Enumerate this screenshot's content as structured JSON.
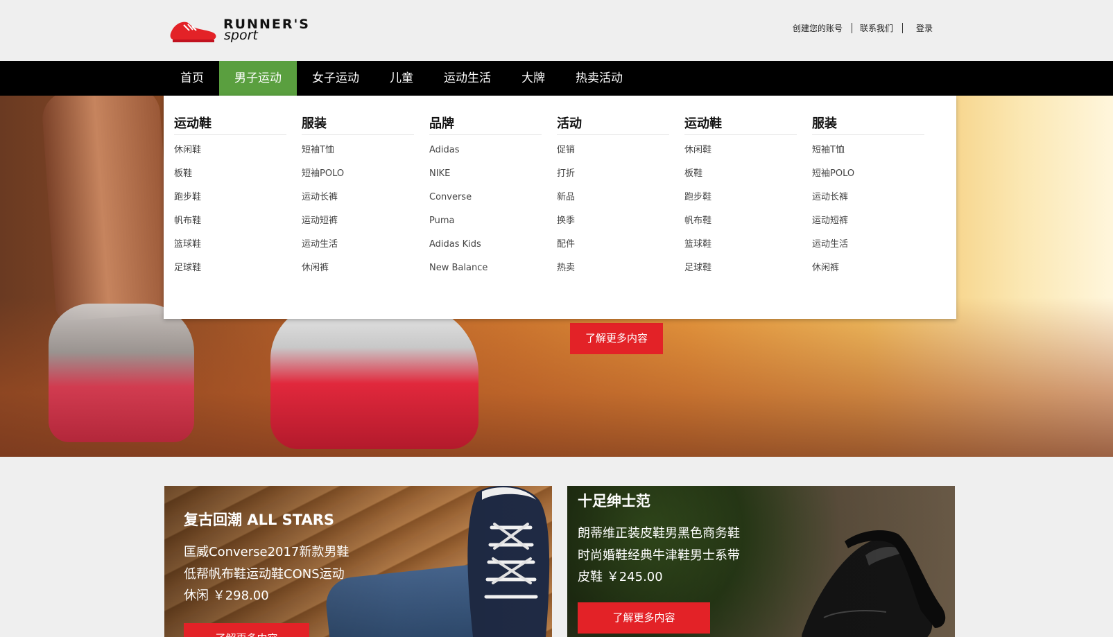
{
  "brand": {
    "line1": "RUNNER'S",
    "line2": "sport",
    "color": "#e32227"
  },
  "utility_links": [
    "创建您的账号",
    "联系我们",
    "登录"
  ],
  "nav": {
    "items": [
      "首页",
      "男子运动",
      "女子运动",
      "儿童",
      "运动生活",
      "大牌",
      "热卖活动"
    ],
    "active": "男子运动",
    "active_color": "#5a9f3f"
  },
  "mega_menu": {
    "columns": [
      {
        "heading": "运动鞋",
        "items": [
          "休闲鞋",
          "板鞋",
          "跑步鞋",
          "帆布鞋",
          "篮球鞋",
          "足球鞋"
        ]
      },
      {
        "heading": "服装",
        "items": [
          "短袖T恤",
          "短袖POLO",
          "运动长裤",
          "运动短裤",
          "运动生活",
          "休闲裤"
        ]
      },
      {
        "heading": "品牌",
        "items": [
          "Adidas",
          "NIKE",
          "Converse",
          "Puma",
          "Adidas Kids",
          "New Balance"
        ]
      },
      {
        "heading": "活动",
        "items": [
          "促销",
          "打折",
          "新品",
          "换季",
          "配件",
          "热卖"
        ]
      },
      {
        "heading": "运动鞋",
        "items": [
          "休闲鞋",
          "板鞋",
          "跑步鞋",
          "帆布鞋",
          "篮球鞋",
          "足球鞋"
        ]
      },
      {
        "heading": "服装",
        "items": [
          "短袖T恤",
          "短袖POLO",
          "运动长裤",
          "运动短裤",
          "运动生活",
          "休闲裤"
        ]
      }
    ]
  },
  "hero": {
    "button_label": "了解更多内容",
    "accent": "#e32227"
  },
  "cards": [
    {
      "title": "复古回潮 ALL STARS",
      "description": "匡威Converse2017新款男鞋低帮帆布鞋运动鞋CONS运动休闲 ￥298.00",
      "button_label": "了解更多内容"
    },
    {
      "title": "十足绅士范",
      "description": "朗蒂维正装皮鞋男黑色商务鞋时尚婚鞋经典牛津鞋男士系带皮鞋 ￥245.00",
      "button_label": "了解更多内容"
    }
  ]
}
